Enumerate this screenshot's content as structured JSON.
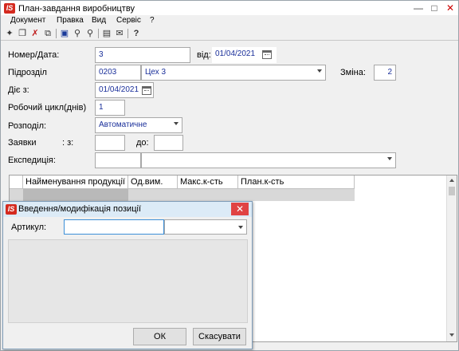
{
  "window": {
    "logo": "IS",
    "title": "План-завдання виробництву",
    "controls": {
      "minimize": "—",
      "maximize": "□",
      "close": "✕"
    }
  },
  "menu": [
    "Документ",
    "Правка",
    "Вид",
    "Сервіс",
    "?"
  ],
  "toolbar_icons": [
    "new-doc-icon",
    "copy-doc-icon",
    "delete-icon",
    "duplicate-icon",
    "save-icon",
    "find-icon",
    "find-next-icon",
    "print-preview-icon",
    "mail-icon",
    "help-icon"
  ],
  "form": {
    "number_label": "Номер/Дата:",
    "number_value": "3",
    "from_label": "від:",
    "date_value": "01/04/2021",
    "subdivision_label": "Підрозділ",
    "subdivision_code": "0203",
    "subdivision_name": "Цех 3",
    "shift_label": "Зміна:",
    "shift_value": "2",
    "valid_from_label": "Діє з:",
    "valid_from_value": "01/04/2021",
    "work_cycle_label": "Робочий цикл(днів)",
    "work_cycle_value": "1",
    "distribution_label": "Розподіл:",
    "distribution_value": "Автоматичне",
    "orders_label": "Заявки",
    "orders_from_label": ": з:",
    "orders_from_value": "",
    "orders_to_label": "до:",
    "orders_to_value": "",
    "expedition_label": "Експедиція:",
    "expedition_code": "",
    "expedition_name": ""
  },
  "table": {
    "columns": [
      "Найменування продукції",
      "Од.вим.",
      "Макс.к-сть",
      "План.к-сть"
    ]
  },
  "dialog": {
    "logo": "IS",
    "title": "Введення/модифікація позиції",
    "article_label": "Артикул:",
    "article_value": "",
    "ok_label": "ОК",
    "cancel_label": "Скасувати",
    "close_glyph": "✕"
  },
  "colors": {
    "field_text": "#1a2f9a",
    "logo": "#d42a1f",
    "close": "#e04343",
    "dialog_title": "#dcebf7",
    "focus_border": "#3c8fd8"
  }
}
